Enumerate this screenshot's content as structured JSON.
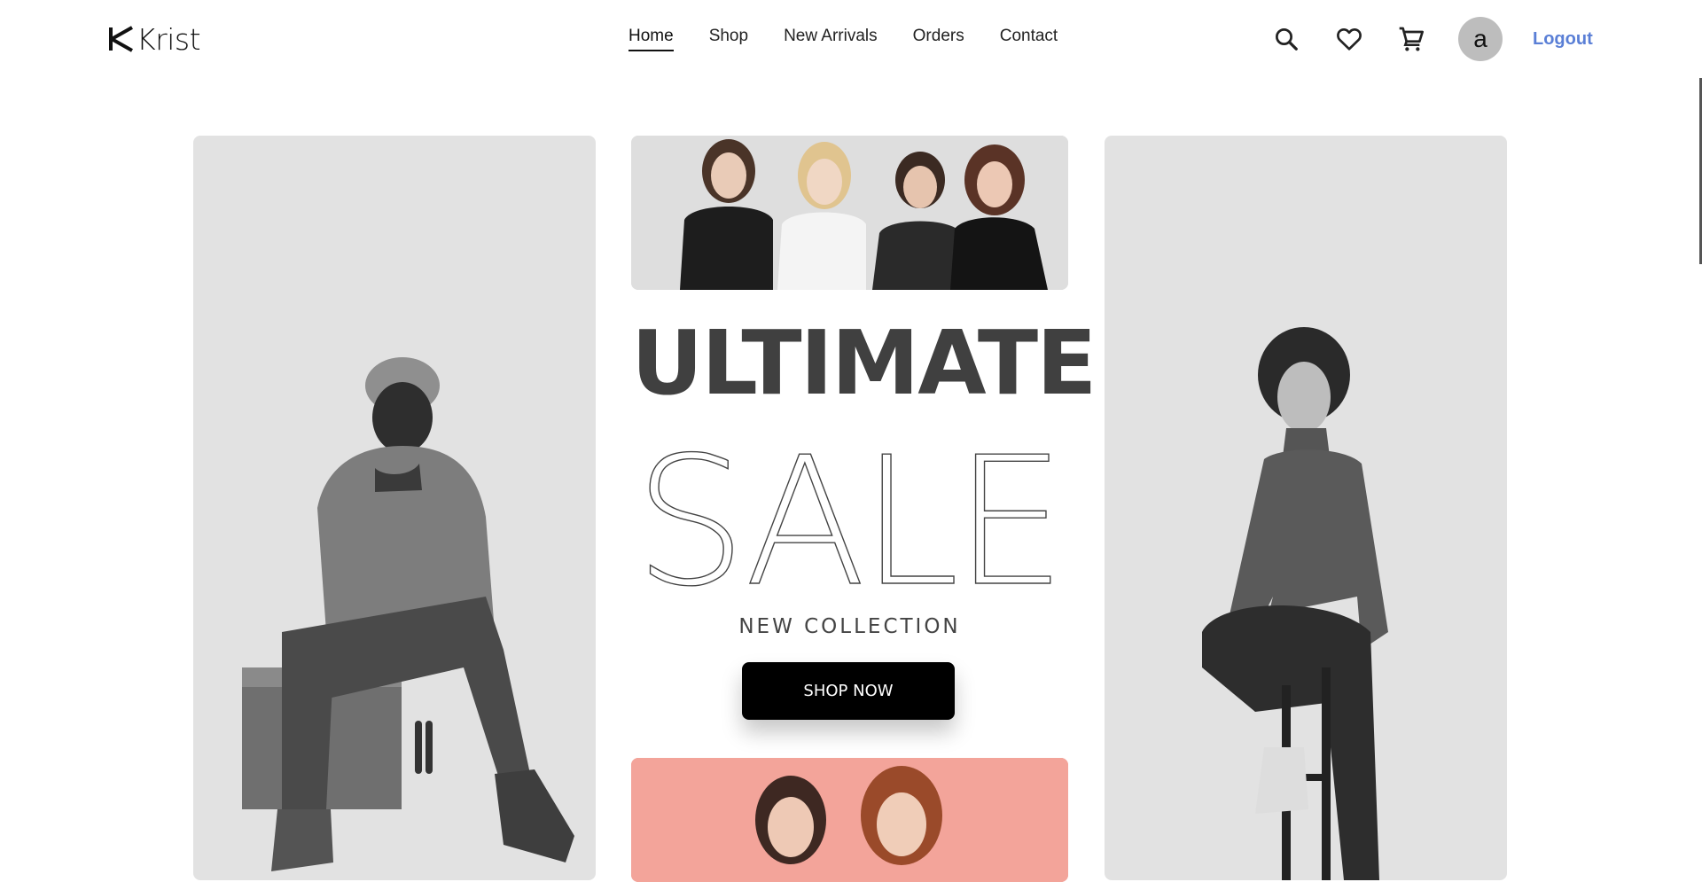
{
  "brand": {
    "name": "Krist"
  },
  "nav": {
    "items": [
      {
        "label": "Home",
        "active": true
      },
      {
        "label": "Shop",
        "active": false
      },
      {
        "label": "New Arrivals",
        "active": false
      },
      {
        "label": "Orders",
        "active": false
      },
      {
        "label": "Contact",
        "active": false
      }
    ]
  },
  "header_actions": {
    "icons": [
      "search-icon",
      "heart-icon",
      "cart-icon"
    ],
    "avatar_initial": "a",
    "logout_label": "Logout",
    "logout_color": "#5a7fd6"
  },
  "hero": {
    "headline_top": "ULTIMATE",
    "headline_outline": "SALE",
    "subtitle": "NEW COLLECTION",
    "cta_label": "SHOP NOW",
    "panel_bg": "#e2e2e2",
    "accent_bg": "#f3a49a"
  }
}
